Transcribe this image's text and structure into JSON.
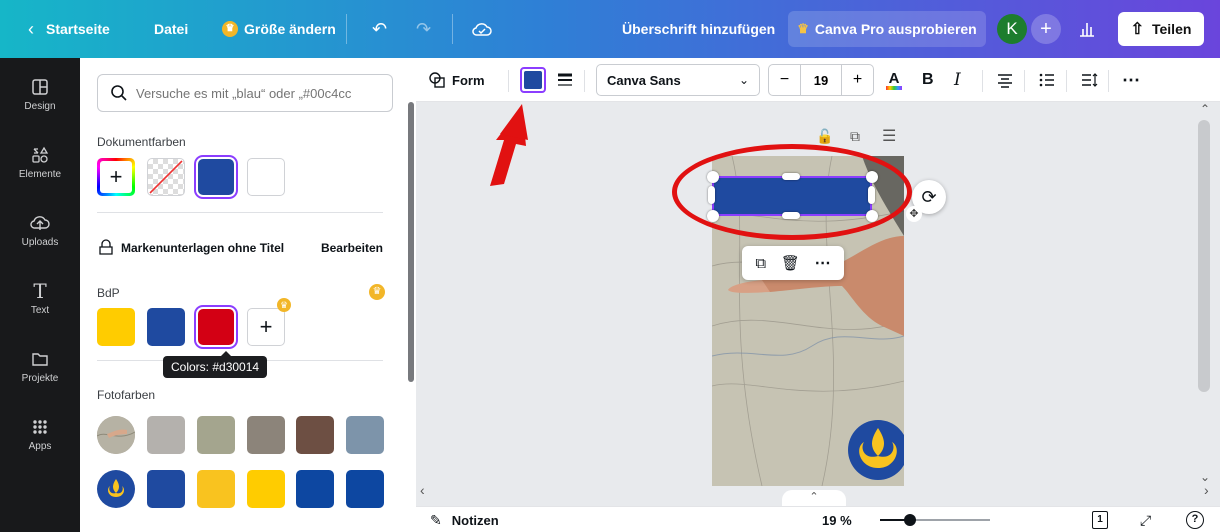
{
  "topbar": {
    "back_label": "Startseite",
    "file_label": "Datei",
    "resize_label": "Größe ändern",
    "heading_label": "Überschrift hinzufügen",
    "pro_label": "Canva Pro ausprobieren",
    "avatar_initial": "K",
    "share_label": "Teilen"
  },
  "rail": [
    {
      "label": "Design",
      "icon": "layout-icon"
    },
    {
      "label": "Elemente",
      "icon": "shapes-icon"
    },
    {
      "label": "Uploads",
      "icon": "cloud-upload-icon"
    },
    {
      "label": "Text",
      "icon": "text-icon"
    },
    {
      "label": "Projekte",
      "icon": "folder-icon"
    },
    {
      "label": "Apps",
      "icon": "apps-grid-icon"
    }
  ],
  "panel": {
    "search_placeholder": "Versuche es mit „blau“ oder „#00c4cc",
    "doc_colors_title": "Dokumentfarben",
    "doc_colors": [
      "#1f4aa0",
      "#ffffff"
    ],
    "brand_kit_title": "Markenunterlagen ohne Titel",
    "brand_edit": "Bearbeiten",
    "palette_title": "BdP",
    "palette_colors": [
      "#ffcc00",
      "#1f4aa0",
      "#d30014"
    ],
    "tooltip": "Colors: #d30014",
    "photo_colors_title": "Fotofarben",
    "photo_row_1": [
      "#b4b1ad",
      "#a4a58e",
      "#8c847a",
      "#6d4f43",
      "#7d94aa"
    ],
    "photo_row_2": [
      "#1f4aa0",
      "#f9c31f",
      "#ffcc00",
      "#0d47a1",
      "#0d47a1"
    ]
  },
  "toolbar": {
    "shape_label": "Form",
    "fill_color": "#1f4aa0",
    "font_name": "Canva Sans",
    "font_size": "19"
  },
  "canvas": {
    "shape_color": "#1f4aa0"
  },
  "bottombar": {
    "notes_label": "Notizen",
    "zoom": "19 %",
    "page_number": "1"
  },
  "colors": {
    "accent": "#8b3dff",
    "annotation": "#e11111"
  }
}
